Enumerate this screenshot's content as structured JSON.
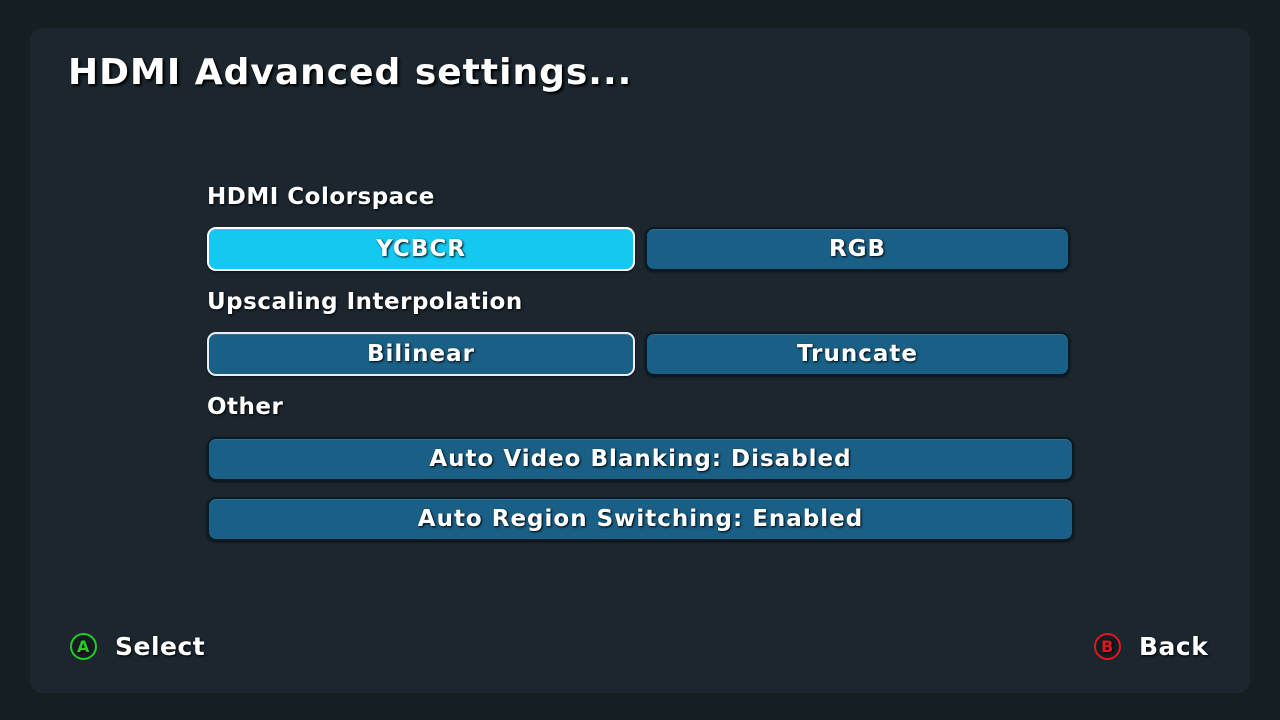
{
  "screen": {
    "title": "HDMI Advanced settings..."
  },
  "sections": {
    "colorspace": {
      "label": "HDMI Colorspace",
      "options": [
        "YCBCR",
        "RGB"
      ],
      "selected": "YCBCR"
    },
    "upscaling": {
      "label": "Upscaling Interpolation",
      "options": [
        "Bilinear",
        "Truncate"
      ],
      "selected": "Bilinear"
    },
    "other": {
      "label": "Other",
      "items": [
        "Auto Video Blanking: Disabled",
        "Auto Region Switching: Enabled"
      ]
    }
  },
  "footer": {
    "select": {
      "glyph": "A",
      "label": "Select",
      "color": "#22cc22",
      "icon": "a-button-icon"
    },
    "back": {
      "glyph": "B",
      "label": "Back",
      "color": "#e0181e",
      "icon": "b-button-icon"
    }
  },
  "colors": {
    "background": "#141e23",
    "panel": "#1b262e",
    "option": "#1a5f86",
    "option_selected": "#14c8f0"
  }
}
